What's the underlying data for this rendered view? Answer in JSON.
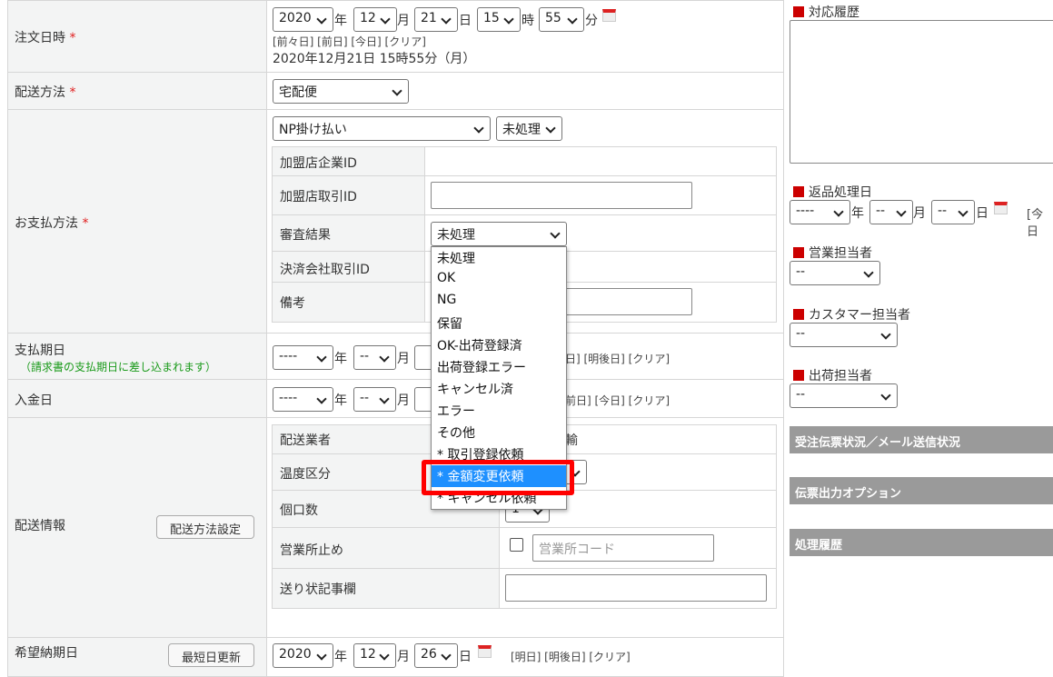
{
  "order_date": {
    "label": "注文日時",
    "required": "*",
    "year": "2020",
    "month": "12",
    "day": "21",
    "hour": "15",
    "minute": "55",
    "u_year": "年",
    "u_month": "月",
    "u_day": "日",
    "u_hour": "時",
    "u_min": "分",
    "links": "[前々日] [前日] [今日] [クリア]",
    "display": "2020年12月21日 15時55分（月）"
  },
  "shipping_method": {
    "label": "配送方法",
    "required": "*",
    "value": "宅配便"
  },
  "payment": {
    "label": "お支払方法",
    "required": "*",
    "method": "NP掛け払い",
    "status": "未処理",
    "fields": {
      "merchant_id": "加盟店企業ID",
      "merchant_txn_id": "加盟店取引ID",
      "review_result": "審査結果",
      "review_value": "未処理",
      "settlement_txn_id": "決済会社取引ID",
      "note": "備考"
    },
    "dropdown_options": [
      "未処理",
      "OK",
      "NG",
      "保留",
      "OK-出荷登録済",
      "出荷登録エラー",
      "キャンセル済",
      "エラー",
      "その他",
      "* 取引登録依頼",
      "* 金額変更依頼",
      "* キャンセル依頼"
    ],
    "selected_option": "* 金額変更依頼"
  },
  "due_date": {
    "label": "支払期日",
    "note": "（請求書の支払期日に差し込まれます）",
    "year": "----",
    "month": "--",
    "links": "日] [明後日] [クリア]"
  },
  "deposit_date": {
    "label": "入金日",
    "year": "----",
    "month": "--",
    "links": "前日] [今日] [クリア]"
  },
  "delivery": {
    "label": "配送情報",
    "settings_button": "配送方法設定",
    "carrier": "配送業者",
    "carrier_value": "輸",
    "temperature": "温度区分",
    "packages": "個口数",
    "packages_value": "1",
    "office_hold": "営業所止め",
    "office_code_placeholder": "営業所コード",
    "slip_note": "送り状記事欄"
  },
  "desired_date": {
    "label": "希望納期日",
    "button": "最短日更新",
    "year": "2020",
    "month": "12",
    "day": "26",
    "links": "[明日] [明後日] [クリア]"
  },
  "right": {
    "history": "対応履歴",
    "return_date": "返品処理日",
    "return_year": "----",
    "return_month": "--",
    "return_day": "--",
    "return_today": "[今日",
    "sales": "営業担当者",
    "customer": "カスタマー担当者",
    "shipping": "出荷担当者",
    "empty": "--",
    "bars": [
      "受注伝票状況／メール送信状況",
      "伝票出力オプション",
      "処理履歴"
    ]
  },
  "colors": {
    "highlight": "#1e90ff",
    "annotation": "#ff0000",
    "required": "#e02020",
    "note_green": "#1a9a1a"
  }
}
